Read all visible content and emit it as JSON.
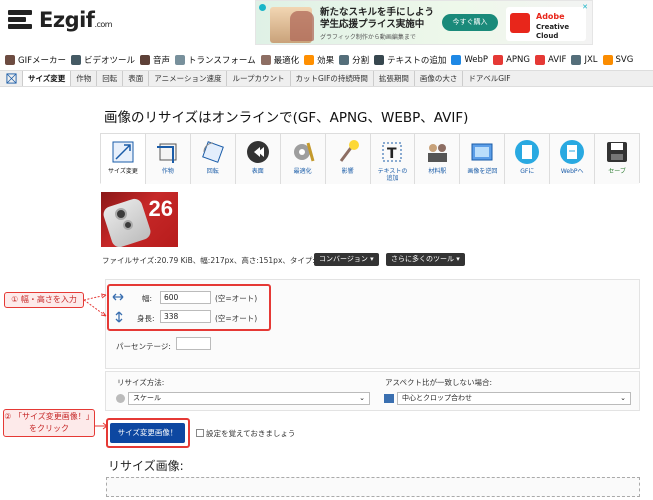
{
  "logo": {
    "name": "Ezgif",
    "suffix": ".com"
  },
  "ad": {
    "title_line1": "新たなスキルを手にしよう",
    "title_line2": "学生応援プライス実施中",
    "subtitle": "グラフィック制作から動画編集まで",
    "cta": "今すぐ購入",
    "brand_line1": "Adobe",
    "brand_line2": "Creative Cloud",
    "close": "✕"
  },
  "menu": [
    {
      "label": "GIFメーカー",
      "icon": "gif-maker-icon",
      "color": "#6d4c41"
    },
    {
      "label": "ビデオツール",
      "icon": "video-icon",
      "color": "#455a64"
    },
    {
      "label": "音声",
      "icon": "audio-icon",
      "color": "#5d4037"
    },
    {
      "label": "トランスフォーム",
      "icon": "transform-icon",
      "color": "#78909c"
    },
    {
      "label": "最適化",
      "icon": "optimize-icon",
      "color": "#8d6e63"
    },
    {
      "label": "効果",
      "icon": "effects-icon",
      "color": "#ff8f00"
    },
    {
      "label": "分割",
      "icon": "split-icon",
      "color": "#546e7a"
    },
    {
      "label": "テキストの追加",
      "icon": "text-icon",
      "color": "#37474f"
    },
    {
      "label": "WebP",
      "icon": "webp-icon",
      "color": "#1e88e5"
    },
    {
      "label": "APNG",
      "icon": "apng-icon",
      "color": "#e53935"
    },
    {
      "label": "AVIF",
      "icon": "avif-icon",
      "color": "#e53935"
    },
    {
      "label": "JXL",
      "icon": "jxl-icon",
      "color": "#546e7a"
    },
    {
      "label": "SVG",
      "icon": "svg-icon",
      "color": "#fb8c00"
    }
  ],
  "submenu": [
    "サイズ変更",
    "作物",
    "回転",
    "表面",
    "アニメーション速度",
    "ループカウント",
    "カットGIFの持続時間",
    "拡張期間",
    "画像の大さ",
    "ドアベルGIF"
  ],
  "page_title": "画像のリサイズはオンラインで(GF、APNG、WEBP、AVIF)",
  "tools": [
    {
      "label": "サイズ変更",
      "icon": "resize-icon"
    },
    {
      "label": "作物",
      "icon": "crop-icon"
    },
    {
      "label": "回転",
      "icon": "rotate-icon"
    },
    {
      "label": "表面",
      "icon": "flip-icon"
    },
    {
      "label": "最適化",
      "icon": "optimize-tool-icon"
    },
    {
      "label": "影響",
      "icon": "effects-tool-icon"
    },
    {
      "label": "テキストの",
      "label2": "追加",
      "icon": "add-text-icon"
    },
    {
      "label": "材料駅",
      "icon": "overlay-icon"
    },
    {
      "label": "画像を逆回",
      "icon": "reverse-icon"
    },
    {
      "label": "GFに",
      "icon": "to-gif-icon"
    },
    {
      "label": "WebPへ",
      "icon": "to-webp-icon"
    },
    {
      "label": "セーブ",
      "icon": "save-icon"
    }
  ],
  "thumbnail_text": "26",
  "file_info": "ファイルサイズ:20.79 KiB、幅:217px、高さ:151px、タイプ:gif*",
  "convert_btn": "コンバージョン ▾",
  "more_tools_btn": "さらに多くのツール ▾",
  "width": {
    "label": "幅:",
    "value": "600",
    "note": "(空=オート)"
  },
  "height": {
    "label": "身長:",
    "value": "338",
    "note": "(空=オート)"
  },
  "percentage_label": "パーセンテージ:",
  "callout1": "① 幅・高さを入力",
  "resize_method": {
    "label": "リサイズ方法:",
    "value": "スケール"
  },
  "aspect": {
    "label": "アスペクト比が一致しない場合:",
    "value": "中心とクロップ合わせ"
  },
  "callout2_line1": "② 「サイズ変更画像！」",
  "callout2_line2": "をクリック",
  "resize_button": "サイズ変更画像！",
  "remember_label": "設定を覚えておきましょう",
  "result_heading": "リサイズ画像:"
}
